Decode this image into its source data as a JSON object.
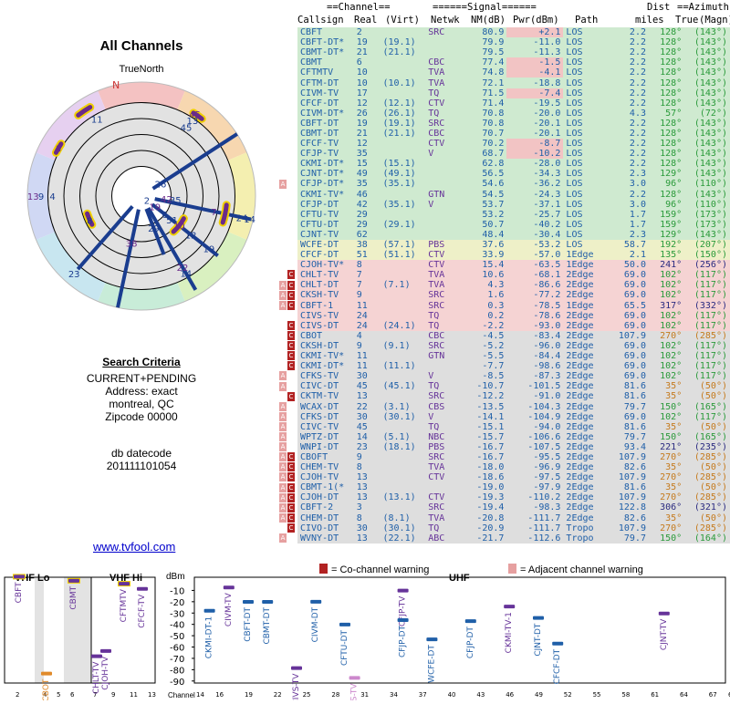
{
  "header": {
    "title": "All Channels",
    "compass_label": "TrueNorth",
    "north_letter": "N"
  },
  "criteria": {
    "title": "Search Criteria",
    "lines": [
      "CURRENT+PENDING",
      "Address: exact",
      "montreal, QC",
      "Zipcode 00000"
    ],
    "db_label": "db datecode",
    "db_value": "201111101054"
  },
  "link_text": "www.tvfool.com",
  "table": {
    "group_headers": {
      "channel": "Channel",
      "signal": "Signal",
      "dist": "Dist",
      "azimuth": "Azimuth"
    },
    "columns": [
      "Callsign",
      "Real",
      "(Virt)",
      "Netwk",
      "NM(dB)",
      "Pwr(dBm)",
      "Path",
      "miles",
      "True",
      "(Magn)"
    ],
    "rows": [
      [
        "CBFT",
        "2",
        "",
        "SRC",
        "80.9",
        "+2.1",
        "LOS",
        "2.2",
        "128°",
        "(143°)",
        "g",
        ""
      ],
      [
        "CBFT-DT*",
        "19",
        "(19.1)",
        "",
        "79.9",
        "-11.0",
        "LOS",
        "2.2",
        "128°",
        "(143°)",
        "g",
        ""
      ],
      [
        "CBMT-DT*",
        "21",
        "(21.1)",
        "",
        "79.5",
        "-11.3",
        "LOS",
        "2.2",
        "128°",
        "(143°)",
        "g",
        ""
      ],
      [
        "CBMT",
        "6",
        "",
        "CBC",
        "77.4",
        "-1.5",
        "LOS",
        "2.2",
        "128°",
        "(143°)",
        "g",
        ""
      ],
      [
        "CFTMTV",
        "10",
        "",
        "TVA",
        "74.8",
        "-4.1",
        "LOS",
        "2.2",
        "128°",
        "(143°)",
        "g",
        ""
      ],
      [
        "CFTM-DT",
        "10",
        "(10.1)",
        "TVA",
        "72.1",
        "-18.8",
        "LOS",
        "2.2",
        "128°",
        "(143°)",
        "g",
        ""
      ],
      [
        "CIVM-TV",
        "17",
        "",
        "TQ",
        "71.5",
        "-7.4",
        "LOS",
        "2.2",
        "128°",
        "(143°)",
        "g",
        ""
      ],
      [
        "CFCF-DT",
        "12",
        "(12.1)",
        "CTV",
        "71.4",
        "-19.5",
        "LOS",
        "2.2",
        "128°",
        "(143°)",
        "g",
        ""
      ],
      [
        "CIVM-DT*",
        "26",
        "(26.1)",
        "TQ",
        "70.8",
        "-20.0",
        "LOS",
        "4.3",
        "57°",
        "(72°)",
        "g",
        ""
      ],
      [
        "CBFT-DT",
        "19",
        "(19.1)",
        "SRC",
        "70.8",
        "-20.1",
        "LOS",
        "2.2",
        "128°",
        "(143°)",
        "g",
        ""
      ],
      [
        "CBMT-DT",
        "21",
        "(21.1)",
        "CBC",
        "70.7",
        "-20.1",
        "LOS",
        "2.2",
        "128°",
        "(143°)",
        "g",
        ""
      ],
      [
        "CFCF-TV",
        "12",
        "",
        "CTV",
        "70.2",
        "-8.7",
        "LOS",
        "2.2",
        "128°",
        "(143°)",
        "g",
        ""
      ],
      [
        "CFJP-TV",
        "35",
        "",
        "V",
        "68.7",
        "-10.2",
        "LOS",
        "2.2",
        "128°",
        "(143°)",
        "g",
        ""
      ],
      [
        "CKMI-DT*",
        "15",
        "(15.1)",
        "",
        "62.8",
        "-28.0",
        "LOS",
        "2.2",
        "128°",
        "(143°)",
        "g",
        ""
      ],
      [
        "CJNT-DT*",
        "49",
        "(49.1)",
        "",
        "56.5",
        "-34.3",
        "LOS",
        "2.3",
        "129°",
        "(143°)",
        "g",
        ""
      ],
      [
        "CFJP-DT*",
        "35",
        "(35.1)",
        "",
        "54.6",
        "-36.2",
        "LOS",
        "3.0",
        "96°",
        "(110°)",
        "g",
        "A"
      ],
      [
        "CKMI-TV*",
        "46",
        "",
        "GTN",
        "54.5",
        "-24.3",
        "LOS",
        "2.2",
        "128°",
        "(143°)",
        "g",
        ""
      ],
      [
        "CFJP-DT",
        "42",
        "(35.1)",
        "V",
        "53.7",
        "-37.1",
        "LOS",
        "3.0",
        "96°",
        "(110°)",
        "g",
        ""
      ],
      [
        "CFTU-TV",
        "29",
        "",
        "",
        "53.2",
        "-25.7",
        "LOS",
        "1.7",
        "159°",
        "(173°)",
        "g",
        ""
      ],
      [
        "CFTU-DT",
        "29",
        "(29.1)",
        "",
        "50.7",
        "-40.2",
        "LOS",
        "1.7",
        "159°",
        "(173°)",
        "g",
        ""
      ],
      [
        "CJNT-TV",
        "62",
        "",
        "",
        "48.4",
        "-30.4",
        "LOS",
        "2.3",
        "129°",
        "(143°)",
        "g",
        ""
      ],
      [
        "WCFE-DT",
        "38",
        "(57.1)",
        "PBS",
        "37.6",
        "-53.2",
        "LOS",
        "58.7",
        "192°",
        "(207°)",
        "y",
        ""
      ],
      [
        "CFCF-DT",
        "51",
        "(51.1)",
        "CTV",
        "33.9",
        "-57.0",
        "1Edge",
        "2.1",
        "135°",
        "(150°)",
        "y",
        ""
      ],
      [
        "CJOH-TV*",
        "8",
        "",
        "CTV",
        "15.4",
        "-63.5",
        "1Edge",
        "50.0",
        "241°",
        "(256°)",
        "r",
        ""
      ],
      [
        "CHLT-TV",
        "7",
        "",
        "TVA",
        "10.6",
        "-68.1",
        "2Edge",
        "69.0",
        "102°",
        "(117°)",
        "r",
        "C"
      ],
      [
        "CHLT-DT",
        "7",
        "(7.1)",
        "TVA",
        "4.3",
        "-86.6",
        "2Edge",
        "69.0",
        "102°",
        "(117°)",
        "r",
        "AC"
      ],
      [
        "CKSH-TV",
        "9",
        "",
        "SRC",
        "1.6",
        "-77.2",
        "2Edge",
        "69.0",
        "102°",
        "(117°)",
        "r",
        "AC"
      ],
      [
        "CBFT-1",
        "11",
        "",
        "SRC",
        "0.3",
        "-78.5",
        "1Edge",
        "65.5",
        "317°",
        "(332°)",
        "r",
        "AC"
      ],
      [
        "CIVS-TV",
        "24",
        "",
        "TQ",
        "0.2",
        "-78.6",
        "2Edge",
        "69.0",
        "102°",
        "(117°)",
        "r",
        ""
      ],
      [
        "CIVS-DT",
        "24",
        "(24.1)",
        "TQ",
        "-2.2",
        "-93.0",
        "2Edge",
        "69.0",
        "102°",
        "(117°)",
        "r",
        "C"
      ],
      [
        "CBOT",
        "4",
        "",
        "CBC",
        "-4.5",
        "-83.4",
        "2Edge",
        "107.9",
        "270°",
        "(285°)",
        "x",
        "C"
      ],
      [
        "CKSH-DT",
        "9",
        "(9.1)",
        "SRC",
        "-5.2",
        "-96.0",
        "2Edge",
        "69.0",
        "102°",
        "(117°)",
        "x",
        "C"
      ],
      [
        "CKMI-TV*",
        "11",
        "",
        "GTN",
        "-5.5",
        "-84.4",
        "2Edge",
        "69.0",
        "102°",
        "(117°)",
        "x",
        "C"
      ],
      [
        "CKMI-DT*",
        "11",
        "(11.1)",
        "",
        "-7.7",
        "-98.6",
        "2Edge",
        "69.0",
        "102°",
        "(117°)",
        "x",
        "C"
      ],
      [
        "CFKS-TV",
        "30",
        "",
        "V",
        "-8.5",
        "-87.3",
        "2Edge",
        "69.0",
        "102°",
        "(117°)",
        "x",
        "A"
      ],
      [
        "CIVC-DT",
        "45",
        "(45.1)",
        "TQ",
        "-10.7",
        "-101.5",
        "2Edge",
        "81.6",
        "35°",
        "(50°)",
        "x",
        "A"
      ],
      [
        "CKTM-TV",
        "13",
        "",
        "SRC",
        "-12.2",
        "-91.0",
        "2Edge",
        "81.6",
        "35°",
        "(50°)",
        "x",
        "C"
      ],
      [
        "WCAX-DT",
        "22",
        "(3.1)",
        "CBS",
        "-13.5",
        "-104.3",
        "2Edge",
        "79.7",
        "150°",
        "(165°)",
        "x",
        "A"
      ],
      [
        "CFKS-DT",
        "30",
        "(30.1)",
        "V",
        "-14.1",
        "-104.9",
        "2Edge",
        "69.0",
        "102°",
        "(117°)",
        "x",
        "A"
      ],
      [
        "CIVC-TV",
        "45",
        "",
        "TQ",
        "-15.1",
        "-94.0",
        "2Edge",
        "81.6",
        "35°",
        "(50°)",
        "x",
        "A"
      ],
      [
        "WPTZ-DT",
        "14",
        "(5.1)",
        "NBC",
        "-15.7",
        "-106.6",
        "2Edge",
        "79.7",
        "150°",
        "(165°)",
        "x",
        "A"
      ],
      [
        "WNPI-DT",
        "23",
        "(18.1)",
        "PBS",
        "-16.7",
        "-107.5",
        "2Edge",
        "93.4",
        "221°",
        "(235°)",
        "x",
        "A"
      ],
      [
        "CBOFT",
        "9",
        "",
        "SRC",
        "-16.7",
        "-95.5",
        "2Edge",
        "107.9",
        "270°",
        "(285°)",
        "x",
        "AC"
      ],
      [
        "CHEM-TV",
        "8",
        "",
        "TVA",
        "-18.0",
        "-96.9",
        "2Edge",
        "82.6",
        "35°",
        "(50°)",
        "x",
        "AC"
      ],
      [
        "CJOH-TV",
        "13",
        "",
        "CTV",
        "-18.6",
        "-97.5",
        "2Edge",
        "107.9",
        "270°",
        "(285°)",
        "x",
        "AC"
      ],
      [
        "CBMT-1(*",
        "13",
        "",
        "",
        "-19.0",
        "-97.9",
        "2Edge",
        "81.6",
        "35°",
        "(50°)",
        "x",
        "AC"
      ],
      [
        "CJOH-DT",
        "13",
        "(13.1)",
        "CTV",
        "-19.3",
        "-110.2",
        "2Edge",
        "107.9",
        "270°",
        "(285°)",
        "x",
        "AC"
      ],
      [
        "CBFT-2",
        "3",
        "",
        "SRC",
        "-19.4",
        "-98.3",
        "2Edge",
        "122.8",
        "306°",
        "(321°)",
        "x",
        "AC"
      ],
      [
        "CHEM-DT",
        "8",
        "(8.1)",
        "TVA",
        "-20.8",
        "-111.7",
        "2Edge",
        "82.6",
        "35°",
        "(50°)",
        "x",
        "AC"
      ],
      [
        "CIVO-DT",
        "30",
        "(30.1)",
        "TQ",
        "-20.9",
        "-111.7",
        "Tropo",
        "107.9",
        "270°",
        "(285°)",
        "x",
        "C"
      ],
      [
        "WVNY-DT",
        "13",
        "(22.1)",
        "ABC",
        "-21.7",
        "-112.6",
        "Tropo",
        "79.7",
        "150°",
        "(164°)",
        "x",
        "A"
      ]
    ]
  },
  "polar": {
    "labels": [
      {
        "t": "45",
        "az": 33,
        "r": 0.86
      },
      {
        "t": "13",
        "az": 34,
        "r": 0.8
      },
      {
        "t": "45",
        "az": 33,
        "r": 0.72
      },
      {
        "t": "3",
        "az": -60,
        "r": 0.84
      },
      {
        "t": "11",
        "az": -30,
        "r": 0.78
      },
      {
        "t": "26",
        "az": 57,
        "r": 0.2
      },
      {
        "t": "13",
        "az": -90,
        "r": 0.95
      },
      {
        "t": "9",
        "az": -90,
        "r": 0.88
      },
      {
        "t": "4",
        "az": -90,
        "r": 0.78
      },
      {
        "t": "42",
        "az": 96,
        "r": 0.22
      },
      {
        "t": "35",
        "az": 96,
        "r": 0.3
      },
      {
        "t": "8",
        "az": -115,
        "r": 0.5
      },
      {
        "t": "38",
        "az": 192,
        "r": 0.42
      },
      {
        "t": "23",
        "az": 221,
        "r": 0.9
      },
      {
        "t": "29",
        "az": 159,
        "r": 0.3
      },
      {
        "t": "22",
        "az": 150,
        "r": 0.72
      },
      {
        "t": "14",
        "az": 150,
        "r": 0.78
      },
      {
        "t": "2",
        "az": 128,
        "r": 0.06
      },
      {
        "t": "19",
        "az": 128,
        "r": 0.15
      },
      {
        "t": "6",
        "az": 128,
        "r": 0.26
      },
      {
        "t": "51",
        "az": 128,
        "r": 0.34
      },
      {
        "t": "10",
        "az": 128,
        "r": 0.42
      },
      {
        "t": "12",
        "az": 128,
        "r": 0.55
      },
      {
        "t": "19",
        "az": 128,
        "r": 0.75
      },
      {
        "t": "7",
        "az": 102,
        "r": 0.65
      },
      {
        "t": "24",
        "az": 102,
        "r": 0.9
      },
      {
        "t": "14",
        "az": 102,
        "r": 0.97
      }
    ],
    "lines": [
      {
        "az": 57,
        "r0": 0.12,
        "r1": 1.0
      },
      {
        "az": 102,
        "r0": 0.12,
        "r1": 0.98
      },
      {
        "az": 128,
        "r0": 0.12,
        "r1": 0.85
      },
      {
        "az": 150,
        "r0": 0.12,
        "r1": 0.95
      },
      {
        "az": 159,
        "r0": 0.12,
        "r1": 0.55
      },
      {
        "az": 192,
        "r0": 0.12,
        "r1": 1.0
      },
      {
        "az": 221,
        "r0": 0.12,
        "r1": 0.85
      }
    ],
    "arcs": [
      {
        "az": -60,
        "r": 0.84,
        "span": 6
      },
      {
        "az": -34,
        "r": 0.9,
        "span": 8
      },
      {
        "az": -114,
        "r": 0.5,
        "span": 12
      },
      {
        "az": 35,
        "r": 0.86,
        "span": 6
      },
      {
        "az": 128,
        "r": 0.42,
        "span": 20
      },
      {
        "az": 102,
        "r": 0.75,
        "span": 12
      }
    ]
  },
  "spectrum": {
    "vhf_lo_label": "VHF Lo",
    "vhf_hi_label": "VHF Hi",
    "uhf_label": "UHF",
    "dbm_label": "dBm",
    "channel_label": "Channel",
    "legend_co": "= Co-channel warning",
    "legend_adj": "= Adjacent channel warning",
    "y_ticks": [
      "-10",
      "-20",
      "-30",
      "-40",
      "-50",
      "-60",
      "-70",
      "-80",
      "-90"
    ],
    "x_ticks_lo": [
      "2",
      "4",
      "5",
      "6"
    ],
    "x_ticks_hi": [
      "7",
      "9",
      "11",
      "13"
    ],
    "x_ticks_uhf": [
      "14",
      "16",
      "19",
      "22",
      "25",
      "28",
      "31",
      "34",
      "37",
      "40",
      "43",
      "46",
      "49",
      "52",
      "55",
      "58",
      "61",
      "64",
      "67",
      "69"
    ],
    "stations": [
      {
        "n": "CBFT",
        "ch": 2,
        "p": 2.1,
        "c": "#663399"
      },
      {
        "n": "CBMT",
        "ch": 6,
        "p": -1.5,
        "c": "#663399"
      },
      {
        "n": "CBOT",
        "ch": 4,
        "p": -83.4,
        "c": "#e08a2a"
      },
      {
        "n": "CHLT-TV",
        "ch": 7,
        "p": -68.1,
        "c": "#663399"
      },
      {
        "n": "CJOH-TV",
        "ch": 8,
        "p": -63.5,
        "c": "#663399"
      },
      {
        "n": "CFTMTV",
        "ch": 10,
        "p": -4.1,
        "c": "#663399"
      },
      {
        "n": "CFCF-TV",
        "ch": 12,
        "p": -8.7,
        "c": "#663399"
      },
      {
        "n": "CKMI-DT-1",
        "ch": 15,
        "p": -28.0,
        "c": "#1f5fa8"
      },
      {
        "n": "CIVM-TV",
        "ch": 17,
        "p": -7.4,
        "c": "#663399"
      },
      {
        "n": "CBFT-DT",
        "ch": 19,
        "p": -20.1,
        "c": "#1f5fa8"
      },
      {
        "n": "CBMT-DT",
        "ch": 21,
        "p": -20.1,
        "c": "#1f5fa8"
      },
      {
        "n": "CIVS-TV",
        "ch": 24,
        "p": -78.6,
        "c": "#663399"
      },
      {
        "n": "CIVM-DT",
        "ch": 26,
        "p": -20.0,
        "c": "#1f5fa8"
      },
      {
        "n": "CFTU-DT",
        "ch": 29,
        "p": -40.2,
        "c": "#1f5fa8"
      },
      {
        "n": "CFKS-TV",
        "ch": 30,
        "p": -87.3,
        "c": "#cc88cc"
      },
      {
        "n": "CFJP-TV",
        "ch": 35,
        "p": -10.2,
        "c": "#663399"
      },
      {
        "n": "CFJP-DT",
        "ch": 35,
        "p": -36.2,
        "c": "#1f5fa8"
      },
      {
        "n": "WCFE-DT",
        "ch": 38,
        "p": -53.2,
        "c": "#1f5fa8"
      },
      {
        "n": "CFJP-DT",
        "ch": 42,
        "p": -37.1,
        "c": "#1f5fa8"
      },
      {
        "n": "CKMI-TV-1",
        "ch": 46,
        "p": -24.3,
        "c": "#663399"
      },
      {
        "n": "CJNT-DT",
        "ch": 49,
        "p": -34.3,
        "c": "#1f5fa8"
      },
      {
        "n": "CFCF-DT",
        "ch": 51,
        "p": -57.0,
        "c": "#1f5fa8"
      },
      {
        "n": "CJNT-TV",
        "ch": 62,
        "p": -30.4,
        "c": "#663399"
      }
    ]
  },
  "chart_data": {
    "type": "bar",
    "title": "All Channels",
    "xlabel": "Channel",
    "ylabel": "dBm",
    "ylim": [
      -90,
      0
    ],
    "categories": [
      "CBFT",
      "CBMT",
      "CFTMTV",
      "CFCF-TV",
      "CIVM-TV",
      "CFJP-TV",
      "CKMI-TV*",
      "CJNT-TV",
      "WCFE-DT",
      "CFCF-DT"
    ],
    "values": [
      2.1,
      -1.5,
      -4.1,
      -8.7,
      -7.4,
      -10.2,
      -24.3,
      -30.4,
      -53.2,
      -57.0
    ]
  }
}
